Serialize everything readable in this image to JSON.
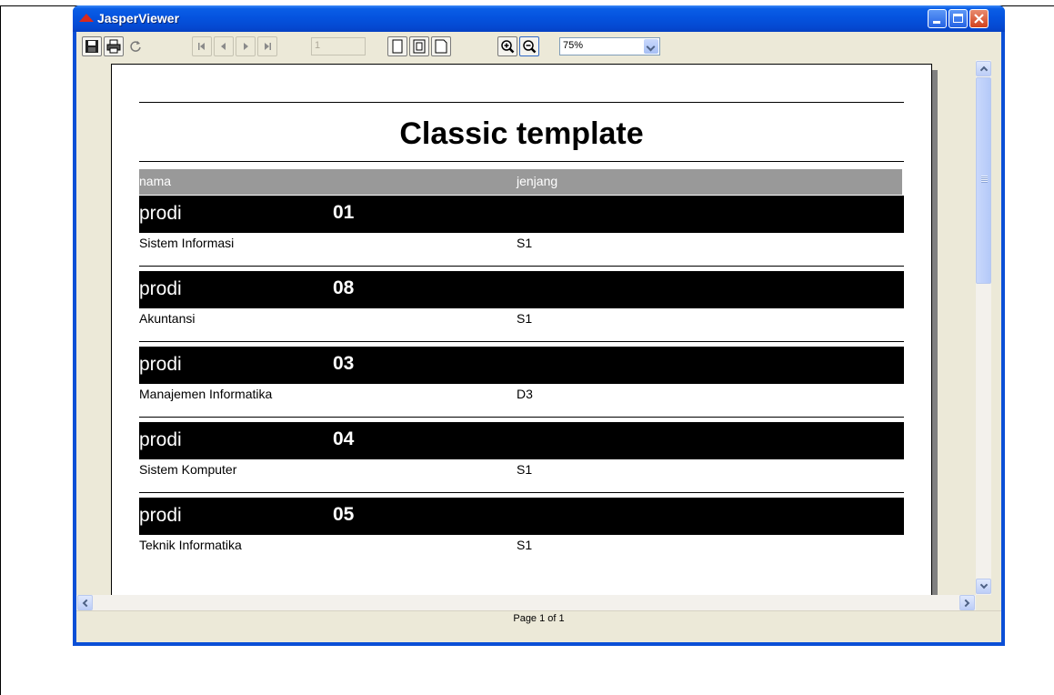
{
  "window": {
    "title": "JasperViewer"
  },
  "toolbar": {
    "page_number": "1",
    "zoom_value": "75%"
  },
  "report": {
    "title": "Classic template",
    "columns": [
      "nama",
      "jenjang"
    ],
    "group_label": "prodi",
    "groups": [
      {
        "code": "01",
        "nama": "Sistem Informasi",
        "jenjang": "S1"
      },
      {
        "code": "08",
        "nama": "Akuntansi",
        "jenjang": "S1"
      },
      {
        "code": "03",
        "nama": "Manajemen Informatika",
        "jenjang": "D3"
      },
      {
        "code": "04",
        "nama": "Sistem Komputer",
        "jenjang": "S1"
      },
      {
        "code": "05",
        "nama": "Teknik Informatika",
        "jenjang": "S1"
      }
    ]
  },
  "status": {
    "page_text": "Page 1 of 1"
  }
}
